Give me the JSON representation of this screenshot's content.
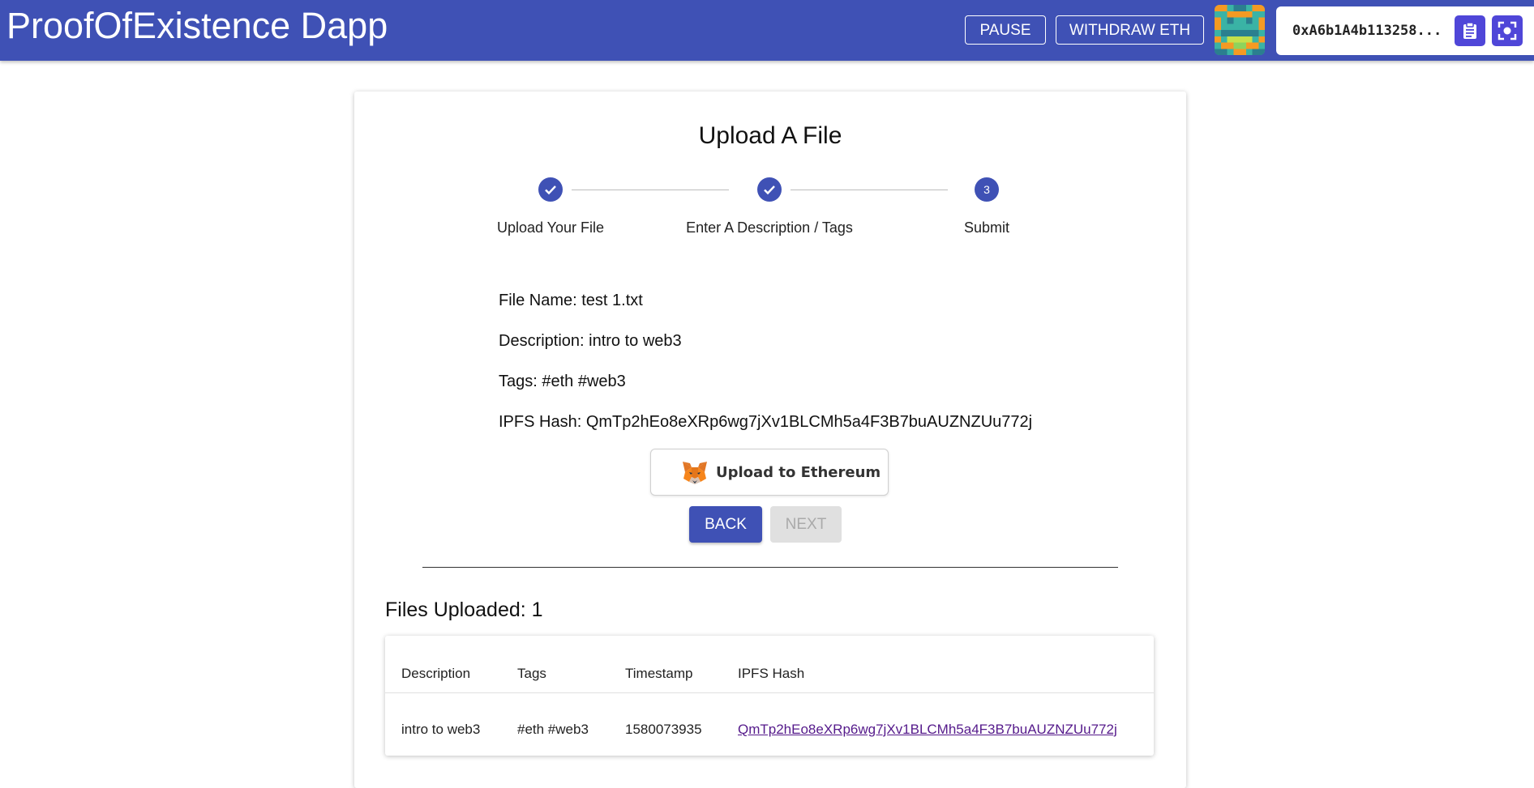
{
  "app": {
    "title": "ProofOfExistence Dapp",
    "pause_label": "PAUSE",
    "withdraw_label": "WITHDRAW ETH",
    "wallet_address": "0xA6b1A4b113258..."
  },
  "uploader": {
    "title": "Upload A File",
    "steps": [
      {
        "label": "Upload Your File",
        "state": "completed",
        "number": "1"
      },
      {
        "label": "Enter A Description / Tags",
        "state": "completed",
        "number": "2"
      },
      {
        "label": "Submit",
        "state": "active",
        "number": "3"
      }
    ],
    "file_name_line": "File Name: test 1.txt",
    "description_line": "Description: intro to web3",
    "tags_line": "Tags: #eth #web3",
    "ipfs_line": "IPFS Hash: QmTp2hEo8eXRp6wg7jXv1BLCMh5a4F3B7buAUZNZUu772j",
    "upload_button_label": "Upload to Ethereum",
    "back_label": "BACK",
    "next_label": "NEXT"
  },
  "files": {
    "heading": "Files Uploaded: 1",
    "columns": [
      "Description",
      "Tags",
      "Timestamp",
      "IPFS Hash"
    ],
    "rows": [
      {
        "description": "intro to web3",
        "tags": "#eth #web3",
        "timestamp": "1580073935",
        "ipfs_hash": "QmTp2hEo8eXRp6wg7jXv1BLCMh5a4F3B7buAUZNZUu772j"
      }
    ]
  },
  "colors": {
    "primary": "#3f51b5",
    "wallet_button": "#4f46d8",
    "link_visited": "#551a8b"
  }
}
